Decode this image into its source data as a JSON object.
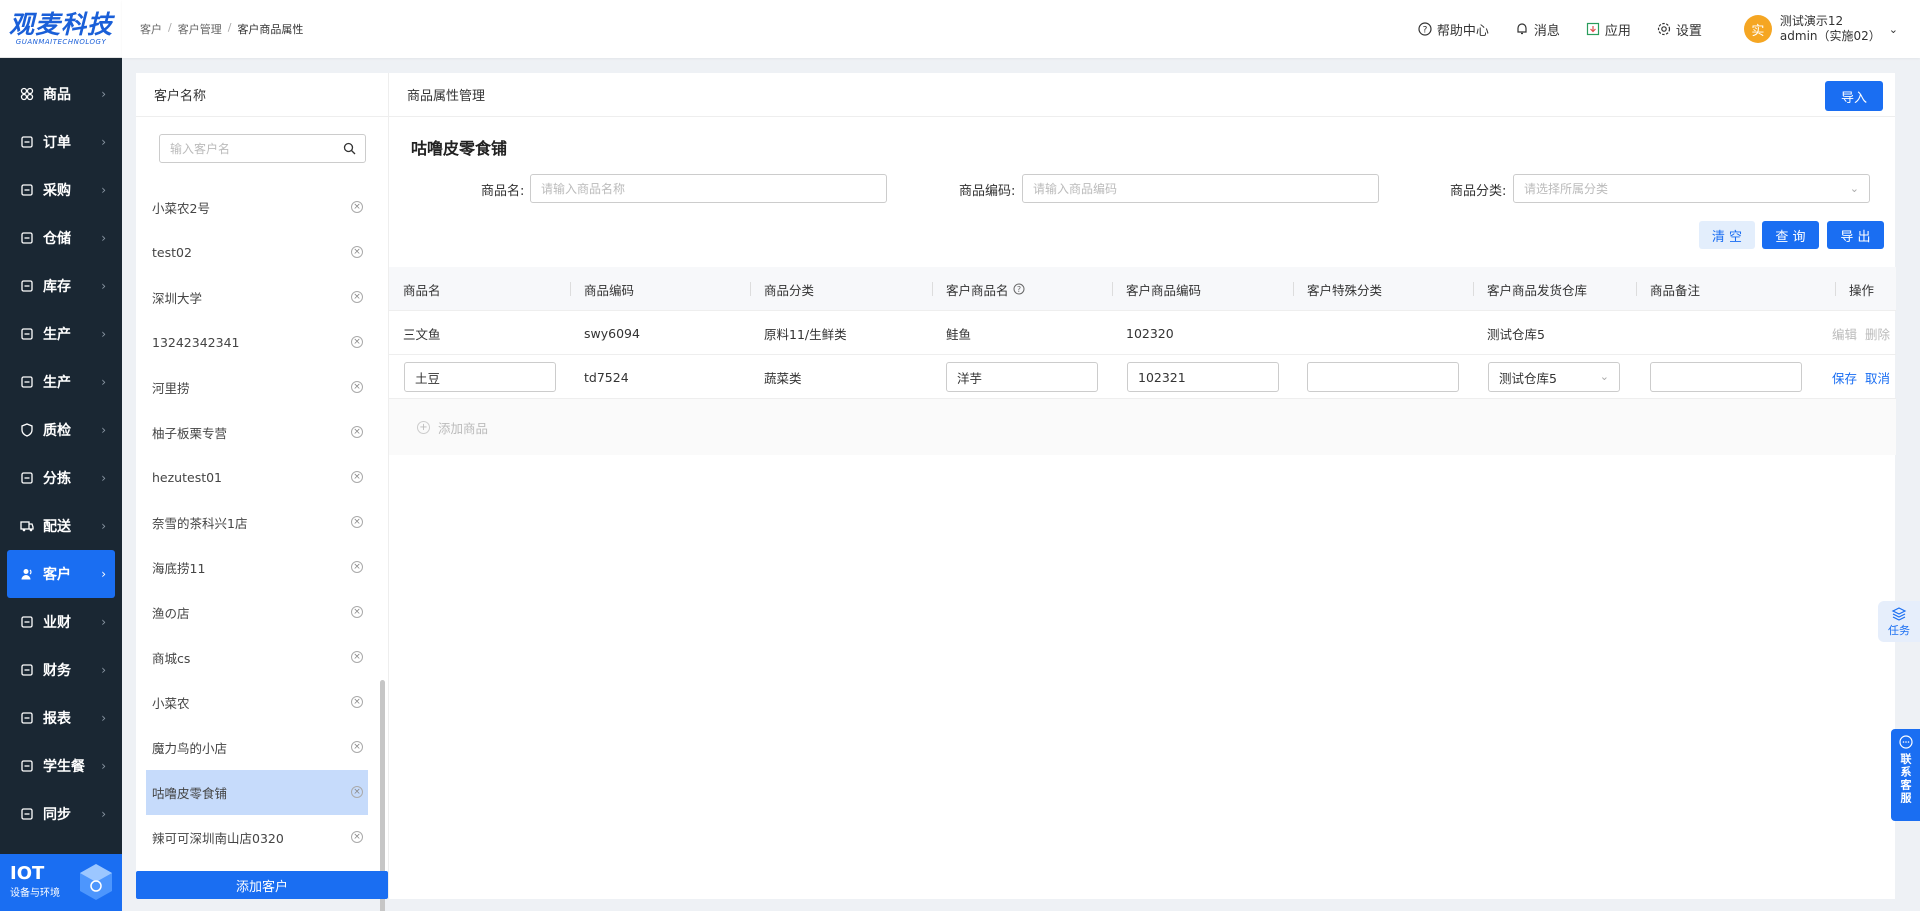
{
  "logo": {
    "cn": "观麦科技",
    "en": "GUANMAITECHNOLOGY"
  },
  "nav": [
    {
      "label": "商品",
      "icon": "grid-icon"
    },
    {
      "label": "订单",
      "icon": "order-icon"
    },
    {
      "label": "采购",
      "icon": "purchase-icon"
    },
    {
      "label": "仓储",
      "icon": "warehouse-icon"
    },
    {
      "label": "库存",
      "icon": "inventory-icon"
    },
    {
      "label": "生产",
      "icon": "production-icon"
    },
    {
      "label": "生产",
      "icon": "production-icon"
    },
    {
      "label": "质检",
      "icon": "shield-icon"
    },
    {
      "label": "分拣",
      "icon": "sorting-icon"
    },
    {
      "label": "配送",
      "icon": "truck-icon"
    },
    {
      "label": "客户",
      "icon": "user-icon"
    },
    {
      "label": "业财",
      "icon": "chart-icon"
    },
    {
      "label": "财务",
      "icon": "finance-icon"
    },
    {
      "label": "报表",
      "icon": "report-icon"
    },
    {
      "label": "学生餐",
      "icon": "meal-icon"
    },
    {
      "label": "同步",
      "icon": "sync-icon"
    }
  ],
  "iot": {
    "title": "IOT",
    "subtitle": "设备与环境"
  },
  "breadcrumb": [
    "客户",
    "客户管理",
    "客户商品属性"
  ],
  "header": {
    "help": "帮助中心",
    "messages": "消息",
    "apps": "应用",
    "settings": "设置",
    "avatar_char": "实",
    "user_line1": "测试演示12",
    "user_line2": "admin（实施02）"
  },
  "customer_panel": {
    "title": "客户名称",
    "search_placeholder": "输入客户名",
    "customers": [
      "小菜农2号",
      "test02",
      "深圳大学",
      "13242342341",
      "河里捞",
      "柚子板栗专营",
      "hezutest01",
      "奈雪的茶科兴1店",
      "海底捞11",
      "渔の店",
      "商城cs",
      "小菜农",
      "魔力鸟的小店",
      "咕噜皮零食铺",
      "辣可可深圳南山店0320"
    ],
    "selected_index": 13,
    "add_button": "添加客户"
  },
  "main": {
    "title": "商品属性管理",
    "import_button": "导入",
    "shop_name": "咕噜皮零食铺",
    "filters": {
      "name_label": "商品名:",
      "name_placeholder": "请输入商品名称",
      "code_label": "商品编码:",
      "code_placeholder": "请输入商品编码",
      "category_label": "商品分类:",
      "category_placeholder": "请选择所属分类"
    },
    "buttons": {
      "clear": "清 空",
      "query": "查 询",
      "export": "导 出"
    },
    "table": {
      "headers": [
        "商品名",
        "商品编码",
        "商品分类",
        "客户商品名",
        "客户商品编码",
        "客户特殊分类",
        "客户商品发货仓库",
        "商品备注",
        "操作"
      ],
      "rows": [
        {
          "name": "三文鱼",
          "code": "swy6094",
          "category": "原料11/生鲜类",
          "cust_name": "鲑鱼",
          "cust_code": "102320",
          "special": "",
          "warehouse": "测试仓库5",
          "remark": "",
          "action1": "编辑",
          "action2": "删除"
        },
        {
          "name": "土豆",
          "code": "td7524",
          "category": "蔬菜类",
          "cust_name": "洋芋",
          "cust_code": "102321",
          "special": "",
          "warehouse": "测试仓库5",
          "remark": "",
          "action1": "保存",
          "action2": "取消"
        }
      ],
      "add_row": "添加商品"
    }
  },
  "floating": {
    "task": "任务",
    "service": "联系客服"
  }
}
